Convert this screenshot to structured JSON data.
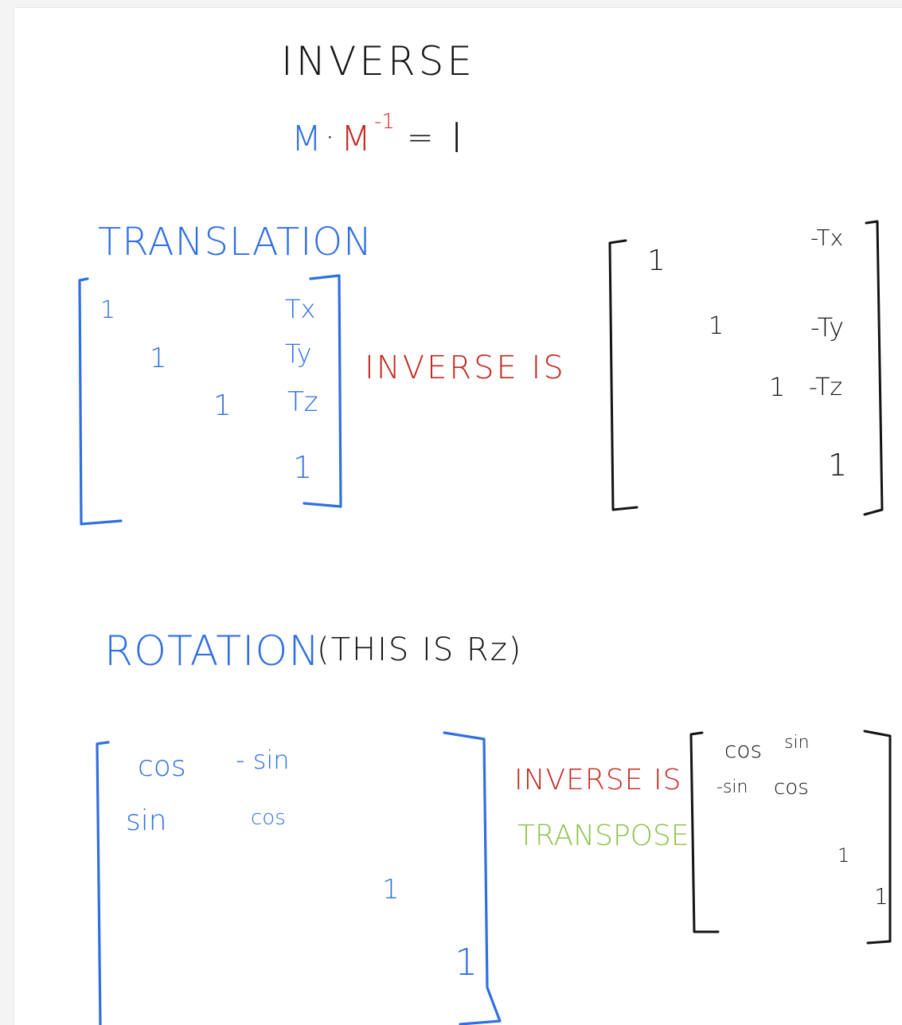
{
  "colors": {
    "ink_black": "#141414",
    "ink_blue": "#2f6fe0",
    "ink_red": "#c3281f",
    "ink_green": "#8fc24a",
    "paper": "#ffffff"
  },
  "title": "INVERSE",
  "identity_equation": {
    "m": "M",
    "dot": "·",
    "m_inv": "M",
    "exponent": "-1",
    "equals": "=",
    "identity": "I"
  },
  "translation": {
    "heading": "TRANSLATION",
    "matrix": [
      "1",
      "Tx",
      "1",
      "Ty",
      "1",
      "Tz",
      "1"
    ],
    "inverse_label": "INVERSE IS",
    "inverse_matrix": [
      "1",
      "-Tx",
      "1",
      "-Ty",
      "1",
      "-Tz",
      "1"
    ]
  },
  "rotation": {
    "heading": "ROTATION",
    "note": "(THIS IS Rz)",
    "matrix": [
      "cos",
      "- sin",
      "sin",
      "cos",
      "1",
      "1"
    ],
    "inverse_label": "INVERSE IS",
    "inverse_label_2": "TRANSPOSE",
    "inverse_matrix": [
      "cos",
      "sin",
      "-sin",
      "cos",
      "1",
      "1"
    ]
  }
}
